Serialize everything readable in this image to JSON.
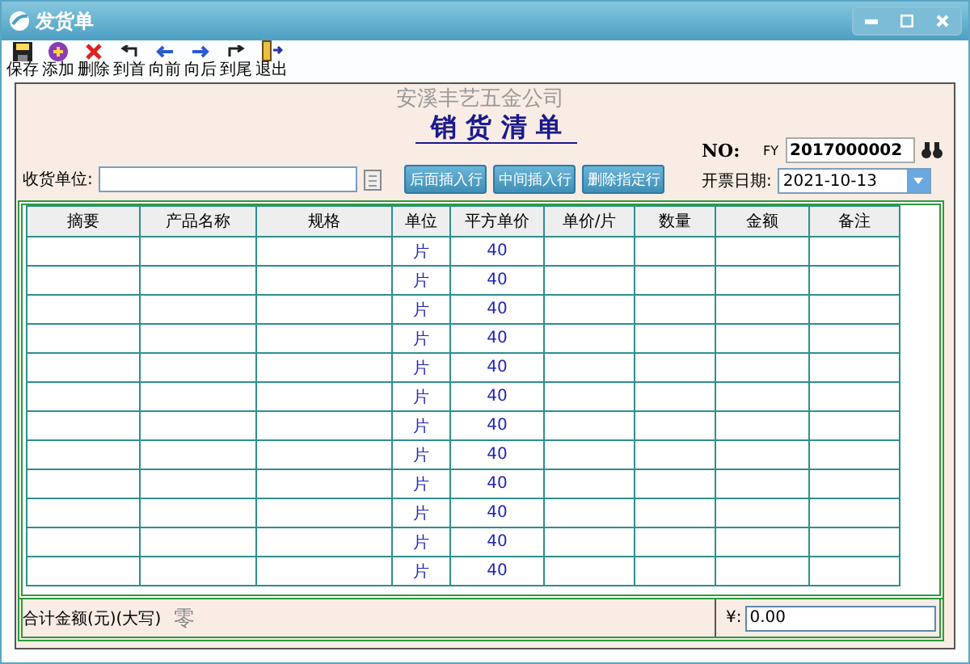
{
  "window": {
    "title": "发货单"
  },
  "toolbar": [
    {
      "label": "保存",
      "kind": "save"
    },
    {
      "label": "添加",
      "kind": "add"
    },
    {
      "label": "删除",
      "kind": "delete"
    },
    {
      "label": "到首",
      "kind": "first"
    },
    {
      "label": "向前",
      "kind": "prev"
    },
    {
      "label": "向后",
      "kind": "next"
    },
    {
      "label": "到尾",
      "kind": "last"
    },
    {
      "label": "退出",
      "kind": "exit"
    }
  ],
  "form": {
    "company": "安溪丰艺五金公司",
    "title": "销 货 清 单",
    "no_label": "NO:",
    "no_prefix": "FY",
    "no_value": "2017000002",
    "receiver_label": "收货单位:",
    "date_label": "开票日期:",
    "date_value": "2021-10-13",
    "buttons": [
      "后面插入行",
      "中间插入行",
      "删除指定行"
    ]
  },
  "table": {
    "columns": [
      "摘要",
      "产品名称",
      "规格",
      "单位",
      "平方单价",
      "单价/片",
      "数量",
      "金额",
      "备注"
    ],
    "rows": [
      {
        "unit": "片",
        "sqm_price": "40"
      },
      {
        "unit": "片",
        "sqm_price": "40"
      },
      {
        "unit": "片",
        "sqm_price": "40"
      },
      {
        "unit": "片",
        "sqm_price": "40"
      },
      {
        "unit": "片",
        "sqm_price": "40"
      },
      {
        "unit": "片",
        "sqm_price": "40"
      },
      {
        "unit": "片",
        "sqm_price": "40"
      },
      {
        "unit": "片",
        "sqm_price": "40"
      },
      {
        "unit": "片",
        "sqm_price": "40"
      },
      {
        "unit": "片",
        "sqm_price": "40"
      },
      {
        "unit": "片",
        "sqm_price": "40"
      },
      {
        "unit": "片",
        "sqm_price": "40"
      }
    ]
  },
  "footer": {
    "total_label": "合计金额(元)(大写)",
    "total_words": "零",
    "currency_label": "¥:",
    "total_value": "0.00"
  }
}
